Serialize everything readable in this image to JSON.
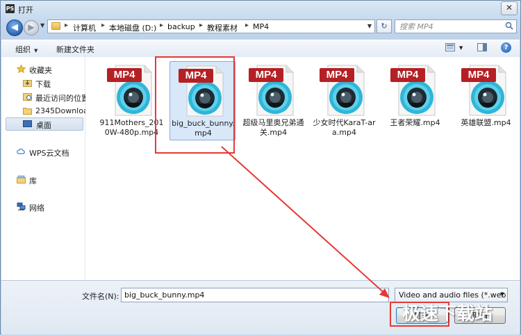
{
  "window": {
    "app_icon": "PS",
    "title": "打开",
    "close_glyph": "✕"
  },
  "address": {
    "crumbs": [
      "计算机",
      "本地磁盘 (D:)",
      "backup",
      "教程素材",
      "MP4"
    ],
    "search_placeholder": "搜索 MP4"
  },
  "toolbar": {
    "organize_label": "组织",
    "new_folder_label": "新建文件夹"
  },
  "nav": {
    "items": [
      {
        "label": "收藏夹",
        "icon": "star-icon"
      },
      {
        "label": "下载",
        "icon": "download-folder-icon"
      },
      {
        "label": "最近访问的位置",
        "icon": "recent-places-icon"
      },
      {
        "label": "2345Downloa",
        "icon": "folder-icon"
      },
      {
        "label": "桌面",
        "icon": "desktop-icon"
      },
      {
        "label": "WPS云文档",
        "icon": "cloud-icon"
      },
      {
        "label": "库",
        "icon": "library-icon"
      },
      {
        "label": "网络",
        "icon": "network-icon"
      }
    ]
  },
  "files": [
    {
      "badge": "MP4",
      "name": "911Mothers_2010W-480p.mp4",
      "selected": false
    },
    {
      "badge": "MP4",
      "name": "big_buck_bunny.mp4",
      "selected": true
    },
    {
      "badge": "MP4",
      "name": "超级马里奥兄弟通关.mp4",
      "selected": false
    },
    {
      "badge": "MP4",
      "name": "少女时代KaraT-ara.mp4",
      "selected": false
    },
    {
      "badge": "MP4",
      "name": "王者荣耀.mp4",
      "selected": false
    },
    {
      "badge": "MP4",
      "name": "英雄联盟.mp4",
      "selected": false
    }
  ],
  "bottom": {
    "filename_label": "文件名(N):",
    "filename_value": "big_buck_bunny.mp4",
    "filetype_value": "Video and audio files (*.web",
    "open_label": "打开",
    "cancel_label": "取消"
  },
  "watermark": "极速下载站",
  "colors": {
    "highlight_red": "#e53935",
    "badge_red": "#b52025",
    "selection_bg": "#d9e8f9"
  }
}
